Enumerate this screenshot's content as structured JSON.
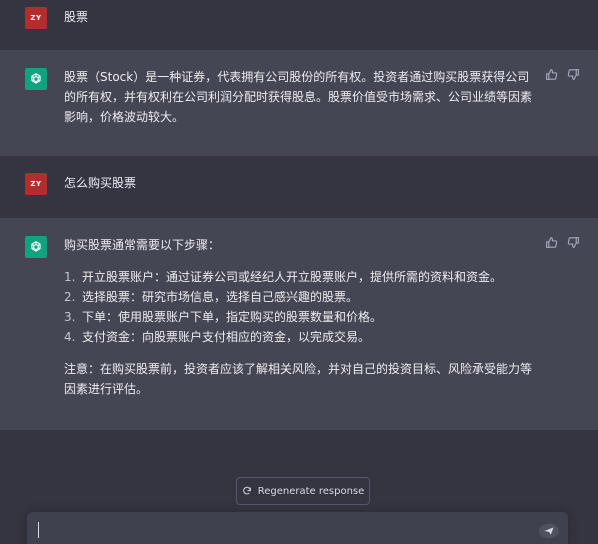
{
  "colors": {
    "background": "#343541",
    "assistant_row": "#444654",
    "user_avatar": "#b32d2d",
    "bot_avatar": "#10a37f",
    "text": "#ececf1"
  },
  "messages": [
    {
      "role": "user",
      "avatar_text": "ZY",
      "text": "股票"
    },
    {
      "role": "assistant",
      "avatar_icon": "openai-logo-icon",
      "text": "股票（Stock）是一种证券，代表拥有公司股份的所有权。投资者通过购买股票获得公司的所有权，并有权利在公司利润分配时获得股息。股票价值受市场需求、公司业绩等因素影响，价格波动较大。"
    },
    {
      "role": "user",
      "avatar_text": "ZY",
      "text": "怎么购买股票"
    },
    {
      "role": "assistant",
      "avatar_icon": "openai-logo-icon",
      "intro": "购买股票通常需要以下步骤：",
      "steps": [
        {
          "num": "1.",
          "text": "开立股票账户：通过证券公司或经纪人开立股票账户，提供所需的资料和资金。"
        },
        {
          "num": "2.",
          "text": "选择股票：研究市场信息，选择自己感兴趣的股票。"
        },
        {
          "num": "3.",
          "text": "下单：使用股票账户下单，指定购买的股票数量和价格。"
        },
        {
          "num": "4.",
          "text": "支付资金：向股票账户支付相应的资金，以完成交易。"
        }
      ],
      "note": "注意：在购买股票前，投资者应该了解相关风险，并对自己的投资目标、风险承受能力等因素进行评估。"
    }
  ],
  "regenerate": {
    "label": "Regenerate response",
    "icon": "refresh-icon"
  },
  "composer": {
    "value": "",
    "send_icon": "send-icon"
  }
}
